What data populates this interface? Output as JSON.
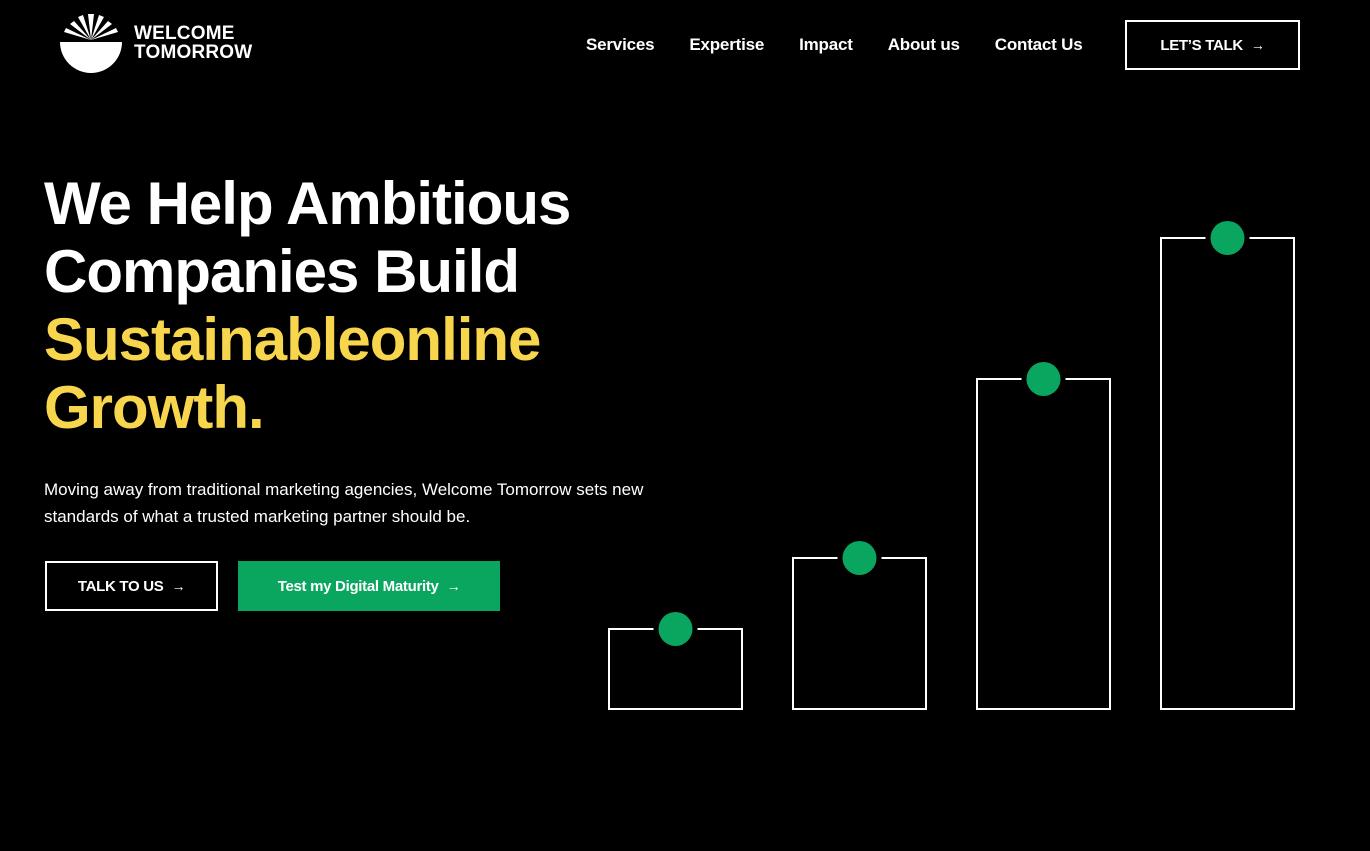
{
  "brand": {
    "line1": "WELCOME",
    "line2": "TOMORROW",
    "icon": "sunrise-bowl-logo-icon"
  },
  "nav": {
    "items": [
      "Services",
      "Expertise",
      "Impact",
      "About us",
      "Contact Us"
    ],
    "cta_label": "LET’S TALK",
    "cta_arrow": "→"
  },
  "hero": {
    "line1": "We Help Ambitious",
    "line2": "Companies Build",
    "line3": "Sustainableonline",
    "line4": "Growth.",
    "subtext": "Moving away from traditional marketing agencies, Welcome Tomorrow sets new standards of what a trusted marketing partner should be.",
    "btn_talk": "TALK TO US",
    "btn_maturity": "Test my Digital Maturity",
    "arrow": "→"
  },
  "colors": {
    "background": "#000000",
    "accent_yellow": "#f7d64e",
    "accent_green": "#0aa660",
    "text": "#ffffff"
  },
  "graphic": {
    "bar_levels": [
      0.17,
      0.32,
      0.7,
      1.0
    ]
  }
}
